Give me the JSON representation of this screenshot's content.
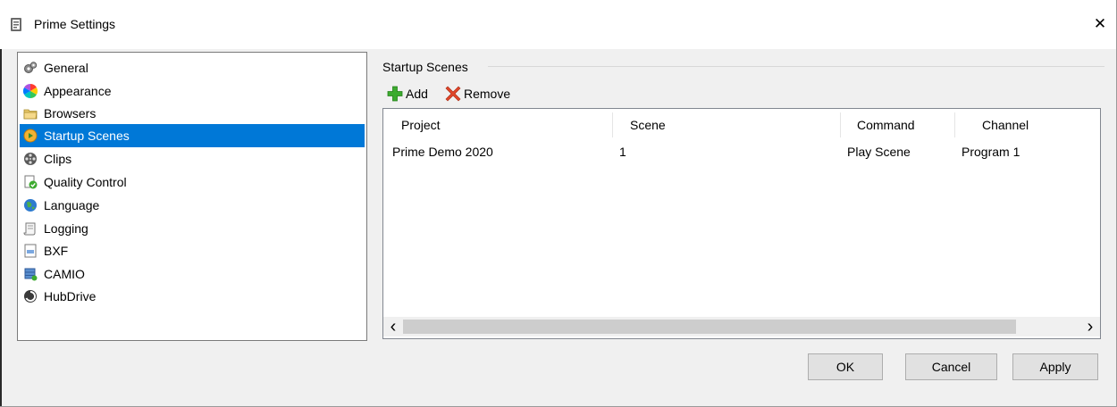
{
  "window": {
    "title": "Prime Settings",
    "title_icon": "app-icon",
    "close_icon": "close-icon",
    "close_glyph": "✕"
  },
  "nav": {
    "items": [
      {
        "label": "General",
        "icon": "gears-icon",
        "selected": false
      },
      {
        "label": "Appearance",
        "icon": "color-wheel-icon",
        "selected": false
      },
      {
        "label": "Browsers",
        "icon": "folder-icon",
        "selected": false
      },
      {
        "label": "Startup Scenes",
        "icon": "startup-scene-icon",
        "selected": true
      },
      {
        "label": "Clips",
        "icon": "film-reel-icon",
        "selected": false
      },
      {
        "label": "Quality Control",
        "icon": "qc-check-icon",
        "selected": false
      },
      {
        "label": "Language",
        "icon": "globe-icon",
        "selected": false
      },
      {
        "label": "Logging",
        "icon": "scroll-icon",
        "selected": false
      },
      {
        "label": "BXF",
        "icon": "document-icon",
        "selected": false
      },
      {
        "label": "CAMIO",
        "icon": "database-icon",
        "selected": false
      },
      {
        "label": "HubDrive",
        "icon": "hubdrive-icon",
        "selected": false
      }
    ]
  },
  "panel": {
    "group_label": "Startup Scenes",
    "add_label": "Add",
    "remove_label": "Remove",
    "columns": [
      "Project",
      "Scene",
      "Command",
      "Channel"
    ],
    "rows": [
      [
        "Prime Demo 2020",
        "1",
        "Play Scene",
        "Program 1"
      ]
    ],
    "scroll_left": "‹",
    "scroll_right": "›"
  },
  "buttons": {
    "ok": "OK",
    "cancel": "Cancel",
    "apply": "Apply"
  },
  "colors": {
    "selection": "#0078d7",
    "add_green": "#3cab2f",
    "remove_red": "#e0462a"
  }
}
